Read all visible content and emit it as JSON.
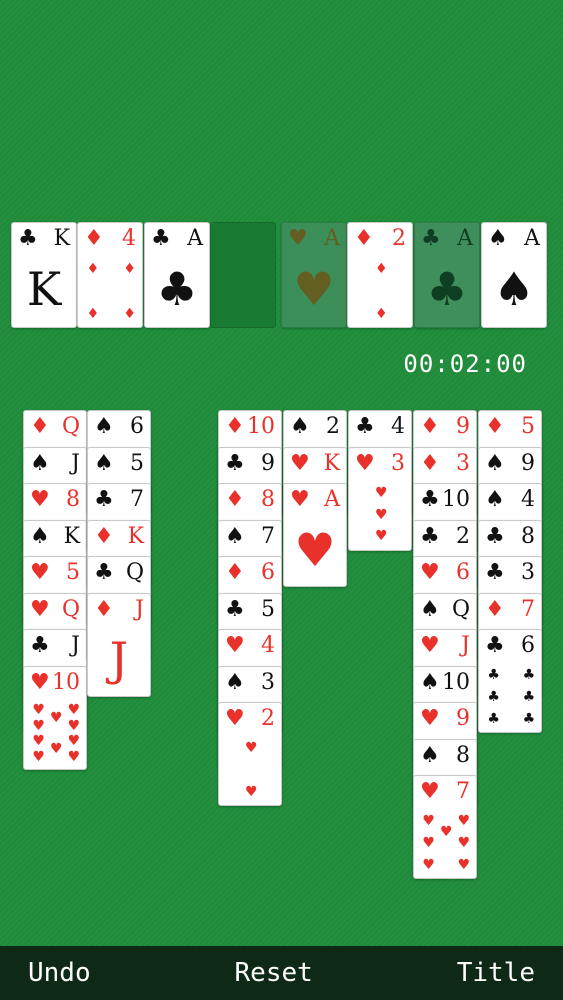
{
  "timer": "00:02:00",
  "toolbar": {
    "undo_label": "Undo",
    "reset_label": "Reset",
    "title_label": "Title"
  },
  "suits": {
    "hearts": "♥",
    "diamonds": "♦",
    "clubs": "♣",
    "spades": "♠"
  },
  "colors": {
    "felt": "#1f8a3a",
    "red": "#e8312b",
    "black": "#111111",
    "bar": "#0e2a16"
  },
  "top_row": [
    {
      "rank": "K",
      "suit": "clubs"
    },
    {
      "rank": "4",
      "suit": "diamonds"
    },
    {
      "rank": "A",
      "suit": "clubs"
    },
    null,
    {
      "rank": "A",
      "suit": "hearts",
      "dim": true
    },
    {
      "rank": "2",
      "suit": "diamonds"
    },
    {
      "rank": "A",
      "suit": "clubs",
      "dim": true
    },
    {
      "rank": "A",
      "suit": "spades"
    }
  ],
  "tableau": [
    [
      {
        "rank": "Q",
        "suit": "diamonds"
      },
      {
        "rank": "J",
        "suit": "spades"
      },
      {
        "rank": "8",
        "suit": "hearts"
      },
      {
        "rank": "K",
        "suit": "spades"
      },
      {
        "rank": "5",
        "suit": "hearts"
      },
      {
        "rank": "Q",
        "suit": "hearts"
      },
      {
        "rank": "J",
        "suit": "clubs"
      },
      {
        "rank": "10",
        "suit": "hearts"
      }
    ],
    [
      {
        "rank": "6",
        "suit": "spades"
      },
      {
        "rank": "5",
        "suit": "spades"
      },
      {
        "rank": "7",
        "suit": "clubs"
      },
      {
        "rank": "K",
        "suit": "diamonds"
      },
      {
        "rank": "Q",
        "suit": "clubs"
      },
      {
        "rank": "J",
        "suit": "diamonds"
      }
    ],
    [],
    [
      {
        "rank": "10",
        "suit": "diamonds"
      },
      {
        "rank": "9",
        "suit": "clubs"
      },
      {
        "rank": "8",
        "suit": "diamonds"
      },
      {
        "rank": "7",
        "suit": "spades"
      },
      {
        "rank": "6",
        "suit": "diamonds"
      },
      {
        "rank": "5",
        "suit": "clubs"
      },
      {
        "rank": "4",
        "suit": "hearts"
      },
      {
        "rank": "3",
        "suit": "spades"
      },
      {
        "rank": "2",
        "suit": "hearts"
      }
    ],
    [
      {
        "rank": "2",
        "suit": "spades"
      },
      {
        "rank": "K",
        "suit": "hearts"
      },
      {
        "rank": "A",
        "suit": "hearts"
      }
    ],
    [
      {
        "rank": "4",
        "suit": "clubs"
      },
      {
        "rank": "3",
        "suit": "hearts"
      }
    ],
    [
      {
        "rank": "9",
        "suit": "diamonds"
      },
      {
        "rank": "3",
        "suit": "diamonds"
      },
      {
        "rank": "10",
        "suit": "clubs"
      },
      {
        "rank": "2",
        "suit": "clubs"
      },
      {
        "rank": "6",
        "suit": "hearts"
      },
      {
        "rank": "Q",
        "suit": "spades"
      },
      {
        "rank": "J",
        "suit": "hearts"
      },
      {
        "rank": "10",
        "suit": "spades"
      },
      {
        "rank": "9",
        "suit": "hearts"
      },
      {
        "rank": "8",
        "suit": "spades"
      },
      {
        "rank": "7",
        "suit": "hearts"
      }
    ],
    [
      {
        "rank": "5",
        "suit": "diamonds"
      },
      {
        "rank": "9",
        "suit": "spades"
      },
      {
        "rank": "4",
        "suit": "spades"
      },
      {
        "rank": "8",
        "suit": "clubs"
      },
      {
        "rank": "3",
        "suit": "clubs"
      },
      {
        "rank": "7",
        "suit": "diamonds"
      },
      {
        "rank": "6",
        "suit": "clubs"
      }
    ]
  ]
}
